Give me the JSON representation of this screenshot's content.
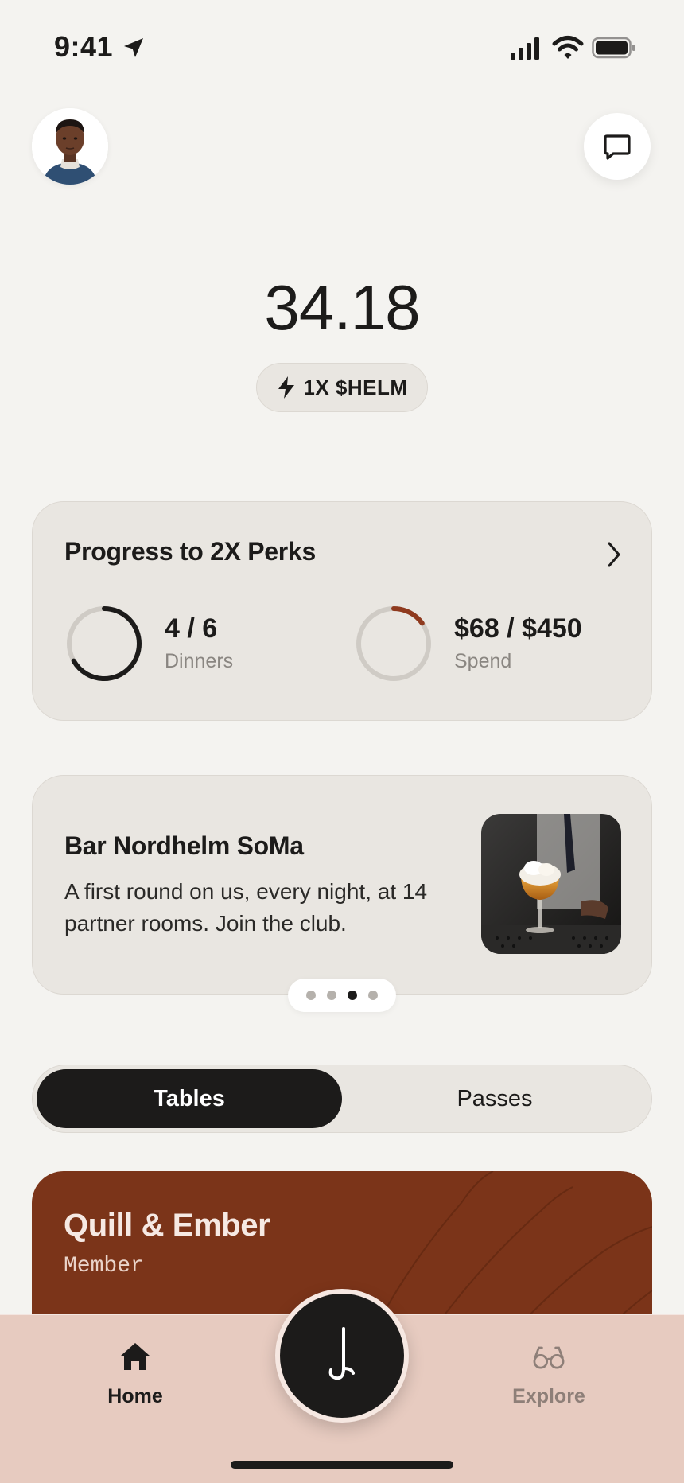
{
  "status_bar": {
    "time": "9:41",
    "icons": [
      "location-arrow-icon",
      "cellular-signal-icon",
      "wifi-icon",
      "battery-icon"
    ]
  },
  "header": {
    "avatar_icon": "user-avatar",
    "chat_icon": "chat-bubble-icon"
  },
  "balance": {
    "value": "34.18",
    "multiplier_icon": "lightning-bolt-icon",
    "multiplier_label": "1X $HELM"
  },
  "progress": {
    "title": "Progress to 2X Perks",
    "chevron_icon": "chevron-right-icon",
    "dinners": {
      "value": "4 / 6",
      "label": "Dinners",
      "fraction": 0.667
    },
    "spend": {
      "value": "$68 / $450",
      "label": "Spend",
      "fraction": 0.151
    },
    "accent_color": "#8f3a1e"
  },
  "promo": {
    "title": "Bar Nordhelm SoMa",
    "body": "A first round on us, every night, at 14 partner rooms. Join the club.",
    "image_icon": "cocktail-photo",
    "pager": {
      "count": 4,
      "active_index": 2
    }
  },
  "segments": {
    "tables": "Tables",
    "passes": "Passes",
    "selected": "Tables"
  },
  "member_card": {
    "name": "Quill & Ember",
    "tier": "Member",
    "color": "#7b3419"
  },
  "tab_bar": {
    "home_label": "Home",
    "home_icon": "house-icon",
    "center_icon": "hook-icon",
    "explore_label": "Explore",
    "explore_icon": "glasses-icon"
  }
}
